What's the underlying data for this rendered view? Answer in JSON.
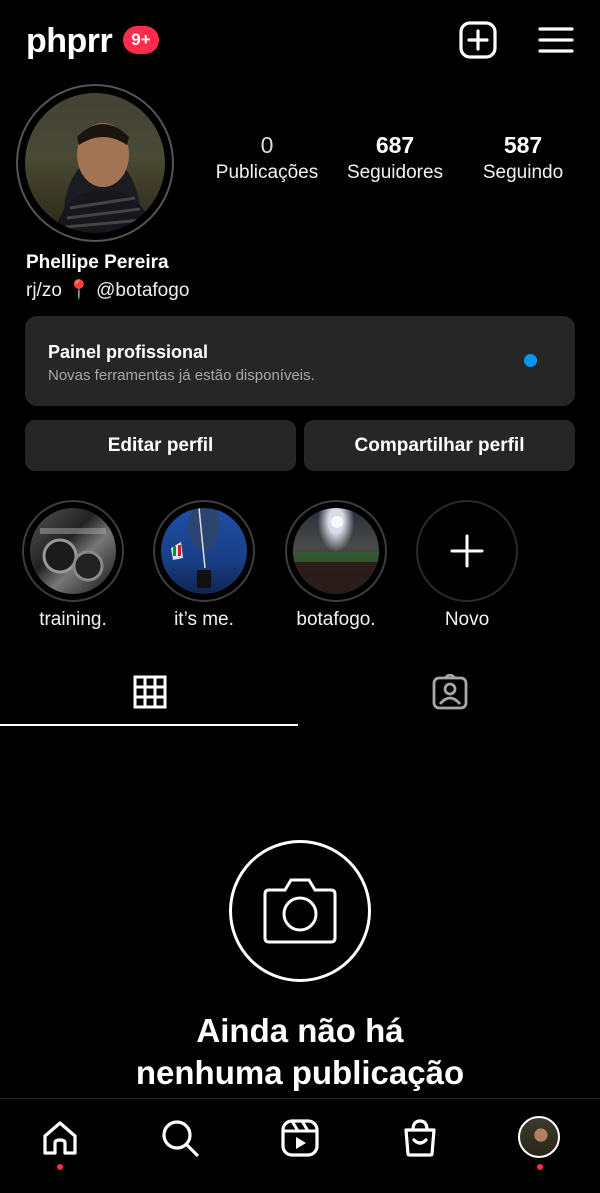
{
  "header": {
    "username": "phprr",
    "notification_badge": "9+"
  },
  "profile": {
    "stats": [
      {
        "value": "0",
        "label": "Publicações"
      },
      {
        "value": "687",
        "label": "Seguidores"
      },
      {
        "value": "587",
        "label": "Seguindo"
      }
    ],
    "full_name": "Phellipe Pereira",
    "bio_prefix": "rj/zo",
    "bio_pin": "📍",
    "bio_handle": "@botafogo"
  },
  "panel": {
    "title": "Painel profissional",
    "subtitle": "Novas ferramentas já estão disponíveis.",
    "dot_color": "#0095f6"
  },
  "buttons": {
    "edit": "Editar perfil",
    "share": "Compartilhar perfil"
  },
  "highlights": [
    {
      "label": "training."
    },
    {
      "label": "it’s me."
    },
    {
      "label": "botafogo."
    },
    {
      "label": "Novo"
    }
  ],
  "tabs": [
    {
      "icon": "grid-icon",
      "active": true
    },
    {
      "icon": "tagged-icon",
      "active": false
    }
  ],
  "empty_state": {
    "line1": "Ainda não há",
    "line2": "nenhuma publicação"
  },
  "bottom_nav": [
    {
      "icon": "home-icon"
    },
    {
      "icon": "search-icon"
    },
    {
      "icon": "reels-icon"
    },
    {
      "icon": "shop-icon"
    },
    {
      "icon": "profile-avatar"
    }
  ],
  "colors": {
    "background": "#000000",
    "surface": "#262626",
    "accent_red": "#ff2c4b",
    "accent_blue": "#0095f6"
  }
}
